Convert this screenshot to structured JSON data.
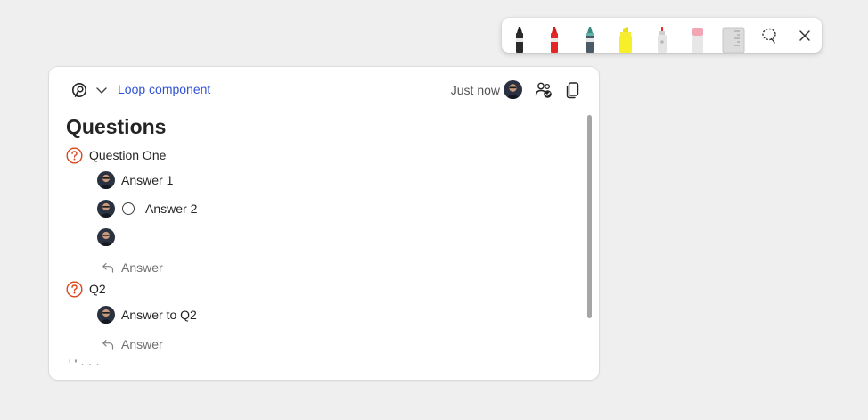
{
  "toolbar": {
    "tools": [
      {
        "name": "pen-black",
        "color": "#222222"
      },
      {
        "name": "pen-red",
        "color": "#e02424"
      },
      {
        "name": "pen-teal",
        "color": "#3f8f86"
      },
      {
        "name": "highlighter-yellow",
        "color": "#f3ea21"
      },
      {
        "name": "laser-pointer",
        "color": "#e03030"
      },
      {
        "name": "eraser",
        "color": "#f2a6b4"
      },
      {
        "name": "ruler",
        "color": "#d9d9d9"
      }
    ],
    "lasso_icon": "lasso-select-icon",
    "close_icon": "close-icon"
  },
  "card": {
    "component_label": "Loop component",
    "timestamp": "Just now",
    "title": "Questions",
    "questions": [
      {
        "text": "Question One",
        "answers": [
          {
            "text": "Answer 1",
            "has_radio": false
          },
          {
            "text": "Answer 2",
            "has_radio": true
          },
          {
            "text": "",
            "has_radio": false
          }
        ],
        "reply_placeholder": "Answer"
      },
      {
        "text": "Q2",
        "answers": [
          {
            "text": "Answer to Q2",
            "has_radio": false
          }
        ],
        "reply_placeholder": "Answer"
      }
    ],
    "cutoff_text": "' '   ·   ·    ·"
  },
  "colors": {
    "link": "#2f52d8",
    "question_icon": "#d9461b",
    "background": "#efefef"
  }
}
